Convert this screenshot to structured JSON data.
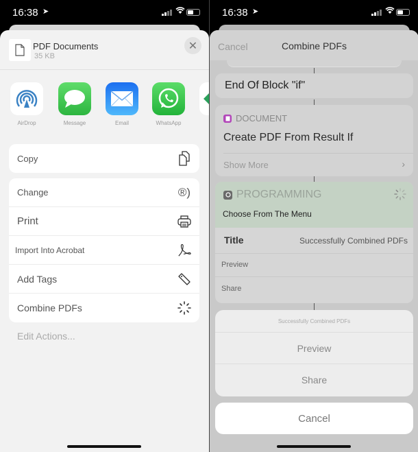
{
  "status_bar": {
    "time": "16:38",
    "location_icon": "location-arrow-icon",
    "signal_icon": "cellular-signal-icon",
    "wifi_icon": "wifi-icon",
    "battery_icon": "battery-icon"
  },
  "left": {
    "header": {
      "title": "PDF Documents",
      "subtitle": "35 KB",
      "close_icon": "close-icon"
    },
    "apps": [
      {
        "label": "AirDrop",
        "icon": "airdrop-icon",
        "color": "#3a82c4"
      },
      {
        "label": "Message",
        "icon": "message-icon",
        "color": "#3cc24e"
      },
      {
        "label": "Email",
        "icon": "mail-icon",
        "color": "#2a8af0"
      },
      {
        "label": "WhatsApp",
        "icon": "whatsapp-icon",
        "color": "#2fc24a"
      }
    ],
    "group1": [
      {
        "label": "Copy",
        "icon": "copy-icon"
      }
    ],
    "group2": [
      {
        "label": "Change",
        "icon": "registered-icon"
      },
      {
        "label": "Print",
        "icon": "printer-icon"
      },
      {
        "label": "Import Into Acrobat",
        "icon": "acrobat-icon"
      },
      {
        "label": "Add Tags",
        "icon": "tag-icon"
      },
      {
        "label": "Combine PDFs",
        "icon": "shortcut-icon"
      }
    ],
    "edit_actions": "Edit Actions..."
  },
  "right": {
    "header": {
      "cancel": "Cancel",
      "title": "Combine PDFs"
    },
    "end_block": "End Of Block \"if\"",
    "document_card": {
      "category": "DOCUMENT",
      "action": "Create PDF From Result If",
      "show_more": "Show More",
      "color": "#b246b9"
    },
    "programming_card": {
      "category": "PROGRAMMING",
      "action": "Choose From The Menu",
      "title_label": "Title",
      "title_value": "Successfully Combined PDFs",
      "options": [
        "Preview",
        "Share"
      ]
    },
    "action_sheet": {
      "title": "Successfully Combined PDFs",
      "options": [
        "Preview",
        "Share"
      ],
      "cancel": "Cancel"
    }
  }
}
